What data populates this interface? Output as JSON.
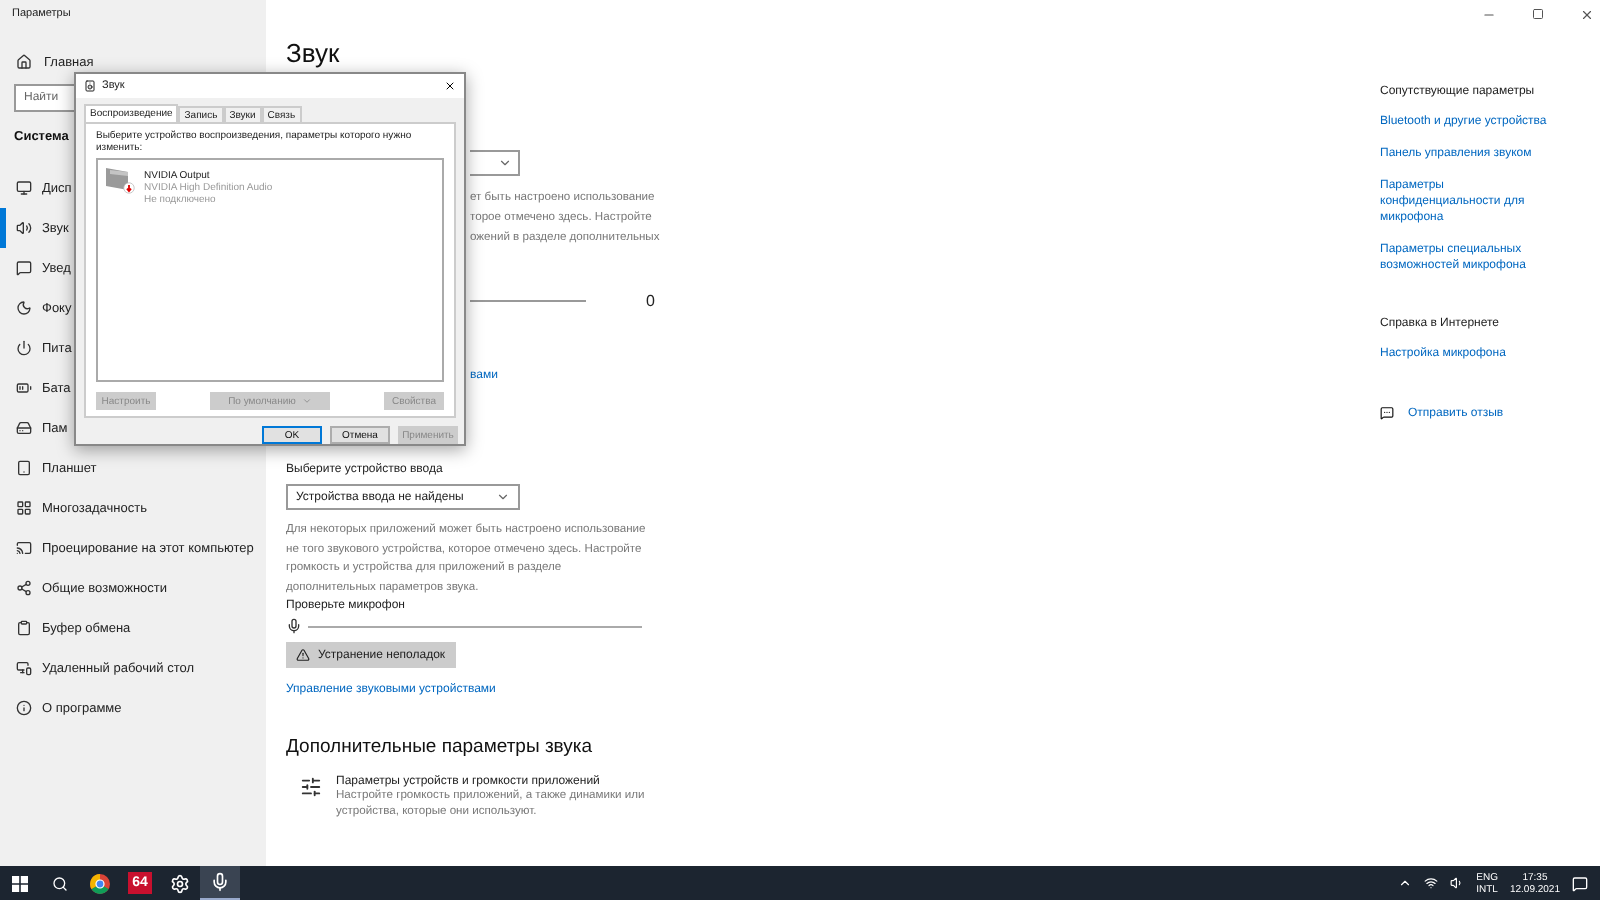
{
  "window": {
    "title": "Параметры"
  },
  "sidebar": {
    "home": "Главная",
    "search_placeholder": "Найти",
    "section": "Система",
    "items": [
      {
        "label": "Дисп",
        "selected": false
      },
      {
        "label": "Звук",
        "selected": true
      },
      {
        "label": "Увед",
        "selected": false
      },
      {
        "label": "Фоку",
        "selected": false
      },
      {
        "label": "Пита",
        "selected": false
      },
      {
        "label": "Бата",
        "selected": false
      },
      {
        "label": "Пам",
        "selected": false
      },
      {
        "label": "Планшет",
        "selected": false
      },
      {
        "label": "Многозадачность",
        "selected": false
      },
      {
        "label": "Проецирование на этот компьютер",
        "selected": false
      },
      {
        "label": "Общие возможности",
        "selected": false
      },
      {
        "label": "Буфер обмена",
        "selected": false
      },
      {
        "label": "Удаленный рабочий стол",
        "selected": false
      },
      {
        "label": "О программе",
        "selected": false
      }
    ]
  },
  "main": {
    "title": "Звук",
    "output_note_lines": [
      "ет быть настроено использование",
      "торое отмечено здесь. Настройте",
      "ожений в разделе дополнительных"
    ],
    "volume_slider": {
      "level": 0
    },
    "volume_value": "0",
    "output_link": "вами",
    "input": {
      "label": "Выберите устройство ввода",
      "device": "Устройства ввода не найдены",
      "note": "Для некоторых приложений может быть настроено использование не того звукового устройства, которое отмечено здесь. Настройте громкость и устройства для приложений в разделе дополнительных параметров звука.",
      "test_label": "Проверьте микрофон",
      "mic_meter": {
        "level": 0
      },
      "troubleshoot": "Устранение неполадок",
      "manage_link": "Управление звуковыми устройствами"
    },
    "advanced": {
      "title": "Дополнительные параметры звука",
      "item_title": "Параметры устройств и громкости приложений",
      "item_desc": "Настройте громкость приложений, а также динамики или устройства, которые они используют."
    }
  },
  "related": {
    "title": "Сопутствующие параметры",
    "links": [
      "Bluetooth и другие устройства",
      "Панель управления звуком",
      "Параметры конфиденциальности для микрофона",
      "Параметры специальных возможностей микрофона"
    ]
  },
  "help": {
    "title": "Справка в Интернете",
    "links": [
      "Настройка микрофона"
    ]
  },
  "feedback": "Отправить отзыв",
  "dialog": {
    "title": "Звук",
    "tabs": [
      {
        "label": "Воспроизведение",
        "selected": true
      },
      {
        "label": "Запись",
        "selected": false
      },
      {
        "label": "Звуки",
        "selected": false
      },
      {
        "label": "Связь",
        "selected": false
      }
    ],
    "instruction": "Выберите устройство воспроизведения, параметры которого нужно изменить:",
    "devices": [
      {
        "name": "NVIDIA Output",
        "driver": "NVIDIA High Definition Audio",
        "status": "Не подключено"
      }
    ],
    "buttons": [
      {
        "label": "Настроить",
        "disabled": true,
        "kind": "plain"
      },
      {
        "label": "По умолчанию",
        "disabled": true,
        "kind": "split"
      },
      {
        "label": "Свойства",
        "disabled": true,
        "kind": "plain"
      }
    ],
    "footer": [
      {
        "label": "OK",
        "disabled": false,
        "default": true
      },
      {
        "label": "Отмена",
        "disabled": false,
        "default": false
      },
      {
        "label": "Применить",
        "disabled": true,
        "default": false
      }
    ]
  },
  "taskbar": {
    "apps": [
      {
        "kind": "browser",
        "active": false
      },
      {
        "kind": "badge",
        "label": "64",
        "active": false
      },
      {
        "kind": "settings",
        "active": false
      },
      {
        "kind": "app",
        "active": true
      }
    ],
    "language": [
      "ENG",
      "INTL"
    ],
    "time": "17:35",
    "date": "12.09.2021"
  }
}
